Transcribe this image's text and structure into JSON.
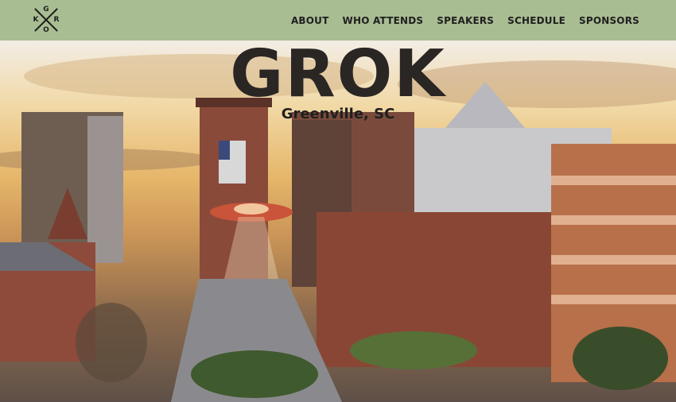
{
  "logo": {
    "letters": {
      "top": "G",
      "right": "R",
      "left": "K",
      "bottom": "O"
    }
  },
  "nav": {
    "about": "ABOUT",
    "who_attends": "WHO ATTENDS",
    "speakers": "SPEAKERS",
    "schedule": "SCHEDULE",
    "sponsors": "SPONSORS"
  },
  "hero": {
    "title": "GROK",
    "subtitle": "Greenville, SC"
  },
  "colors": {
    "header_bg": "#a9bd92",
    "title": "#2a2624"
  }
}
